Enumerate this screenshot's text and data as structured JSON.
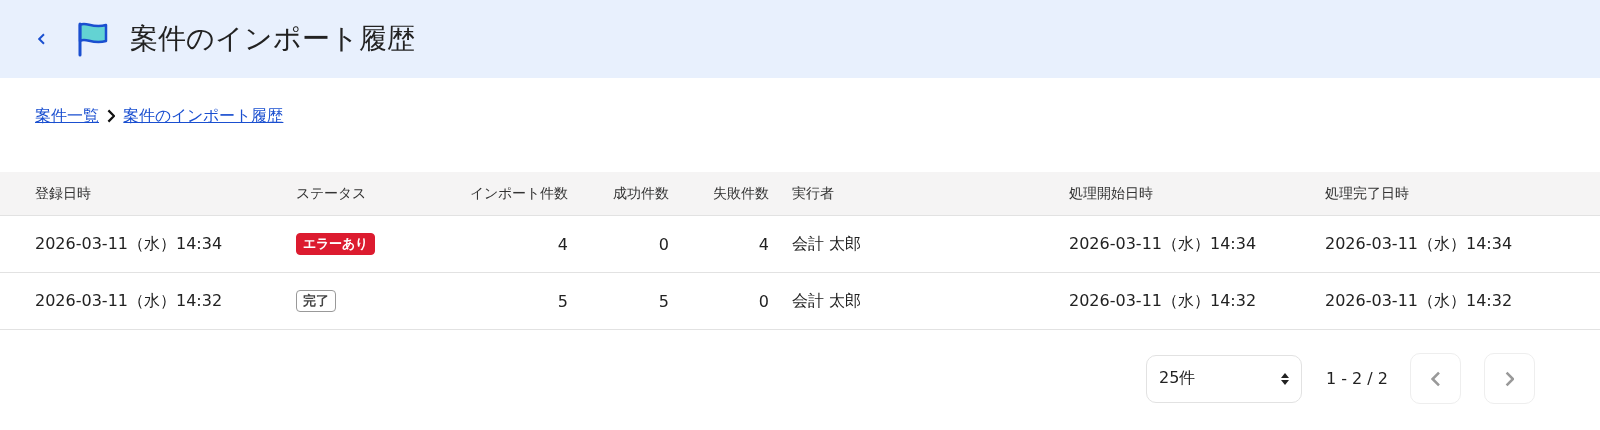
{
  "header": {
    "title": "案件のインポート履歴"
  },
  "breadcrumb": [
    {
      "label": "案件一覧"
    },
    {
      "label": "案件のインポート履歴"
    }
  ],
  "table": {
    "columns": [
      "登録日時",
      "ステータス",
      "インポート件数",
      "成功件数",
      "失敗件数",
      "実行者",
      "処理開始日時",
      "処理完了日時"
    ],
    "rows": [
      {
        "registered": "2026-03-11（水）14:34",
        "status": {
          "label": "エラーあり",
          "kind": "error"
        },
        "imported": "4",
        "succeeded": "0",
        "failed": "4",
        "executor": "会計 太郎",
        "started": "2026-03-11（水）14:34",
        "finished": "2026-03-11（水）14:34"
      },
      {
        "registered": "2026-03-11（水）14:32",
        "status": {
          "label": "完了",
          "kind": "done"
        },
        "imported": "5",
        "succeeded": "5",
        "failed": "0",
        "executor": "会計 太郎",
        "started": "2026-03-11（水）14:32",
        "finished": "2026-03-11（水）14:32"
      }
    ]
  },
  "pagination": {
    "per_page": "25件",
    "range": "1 - 2 / 2",
    "prev_disabled": true,
    "next_disabled": true
  }
}
